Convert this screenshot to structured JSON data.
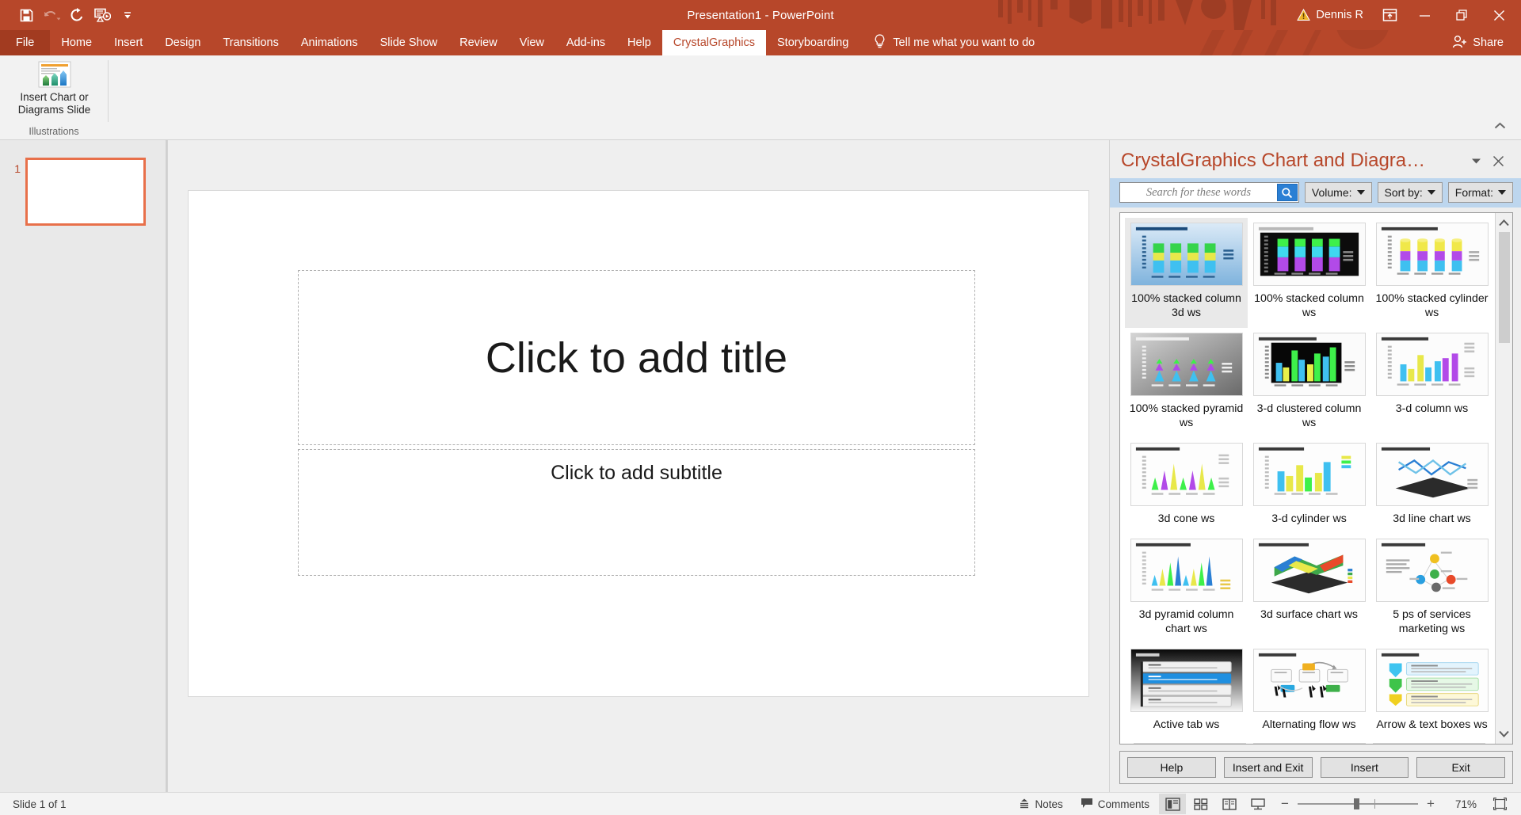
{
  "titlebar": {
    "document_title": "Presentation1  -  PowerPoint",
    "account_name": "Dennis R",
    "quick_access": [
      {
        "name": "save-icon",
        "label": "Save"
      },
      {
        "name": "undo-icon",
        "label": "Undo"
      },
      {
        "name": "redo-icon",
        "label": "Redo"
      },
      {
        "name": "start-presentation-icon",
        "label": "Start From Beginning"
      },
      {
        "name": "customize-qat-icon",
        "label": "Customize Quick Access Toolbar"
      }
    ],
    "window_controls": {
      "ribbon_display_options": "Ribbon Display Options",
      "minimize": "Minimize",
      "restore": "Restore Down",
      "close": "Close"
    }
  },
  "ribbon": {
    "tabs": [
      {
        "label": "File",
        "active": false,
        "kind": "file"
      },
      {
        "label": "Home",
        "active": false
      },
      {
        "label": "Insert",
        "active": false
      },
      {
        "label": "Design",
        "active": false
      },
      {
        "label": "Transitions",
        "active": false
      },
      {
        "label": "Animations",
        "active": false
      },
      {
        "label": "Slide Show",
        "active": false
      },
      {
        "label": "Review",
        "active": false
      },
      {
        "label": "View",
        "active": false
      },
      {
        "label": "Add-ins",
        "active": false
      },
      {
        "label": "Help",
        "active": false
      },
      {
        "label": "CrystalGraphics",
        "active": true
      },
      {
        "label": "Storyboarding",
        "active": false
      }
    ],
    "tell_me": "Tell me what you want to do",
    "share_label": "Share",
    "group": {
      "button_label": "Insert Chart or Diagrams Slide",
      "group_title": "Illustrations"
    },
    "collapse_tooltip": "Collapse the Ribbon"
  },
  "thumbnail_pane": {
    "slides": [
      {
        "number": "1",
        "selected": true
      }
    ]
  },
  "slide": {
    "title_placeholder": "Click to add title",
    "subtitle_placeholder": "Click to add subtitle"
  },
  "taskpane": {
    "title": "CrystalGraphics Chart and Diagra…",
    "caret_tooltip": "Task Pane Options",
    "close_tooltip": "Close",
    "search": {
      "value": "",
      "placeholder": "Search for these words",
      "button": "search-icon"
    },
    "filters": [
      {
        "label": "Volume:",
        "name": "volume-dropdown"
      },
      {
        "label": "Sort by:",
        "name": "sort-by-dropdown"
      },
      {
        "label": "Format:",
        "name": "format-dropdown"
      }
    ],
    "items": [
      {
        "caption": "100% stacked column 3d ws",
        "selected": true,
        "style": "col3d-blue"
      },
      {
        "caption": "100% stacked column ws",
        "selected": false,
        "style": "col-dark"
      },
      {
        "caption": "100% stacked cylinder ws",
        "selected": false,
        "style": "cyl-light"
      },
      {
        "caption": "100% stacked pyramid ws",
        "selected": false,
        "style": "pyr-gray"
      },
      {
        "caption": "3-d clustered column ws",
        "selected": false,
        "style": "clust-dark"
      },
      {
        "caption": "3-d column ws",
        "selected": false,
        "style": "col-light"
      },
      {
        "caption": "3d cone ws",
        "selected": false,
        "style": "cone-light"
      },
      {
        "caption": "3-d cylinder ws",
        "selected": false,
        "style": "cyl2-light"
      },
      {
        "caption": "3d line chart ws",
        "selected": false,
        "style": "line-light"
      },
      {
        "caption": "3d pyramid column chart ws",
        "selected": false,
        "style": "pyr2-light"
      },
      {
        "caption": "3d surface chart ws",
        "selected": false,
        "style": "surface-light"
      },
      {
        "caption": "5 ps of services marketing ws",
        "selected": false,
        "style": "bubbles-light"
      },
      {
        "caption": "Active tab ws",
        "selected": false,
        "style": "tabs-dark"
      },
      {
        "caption": "Alternating flow ws",
        "selected": false,
        "style": "flow-light"
      },
      {
        "caption": "Arrow & text boxes ws",
        "selected": false,
        "style": "arrows-light"
      }
    ],
    "footer_buttons": [
      {
        "label": "Help",
        "name": "help-button"
      },
      {
        "label": "Insert and Exit",
        "name": "insert-and-exit-button"
      },
      {
        "label": "Insert",
        "name": "insert-button"
      },
      {
        "label": "Exit",
        "name": "exit-button"
      }
    ]
  },
  "statusbar": {
    "slide_indicator": "Slide 1 of 1",
    "notes_label": "Notes",
    "comments_label": "Comments",
    "views": [
      {
        "name": "view-normal",
        "label": "Normal",
        "active": true
      },
      {
        "name": "view-slide-sorter",
        "label": "Slide Sorter",
        "active": false
      },
      {
        "name": "view-reading",
        "label": "Reading View",
        "active": false
      },
      {
        "name": "view-slide-show",
        "label": "Slide Show",
        "active": false
      }
    ],
    "zoom": {
      "minus": "−",
      "plus": "+",
      "level": "71%",
      "fit_label": "Fit slide to current window"
    }
  },
  "colors": {
    "accent": "#b7472a",
    "file_tab": "#a23b20",
    "toolbar_blue": "#bdd6ee",
    "thumb_select": "#e8704a"
  }
}
